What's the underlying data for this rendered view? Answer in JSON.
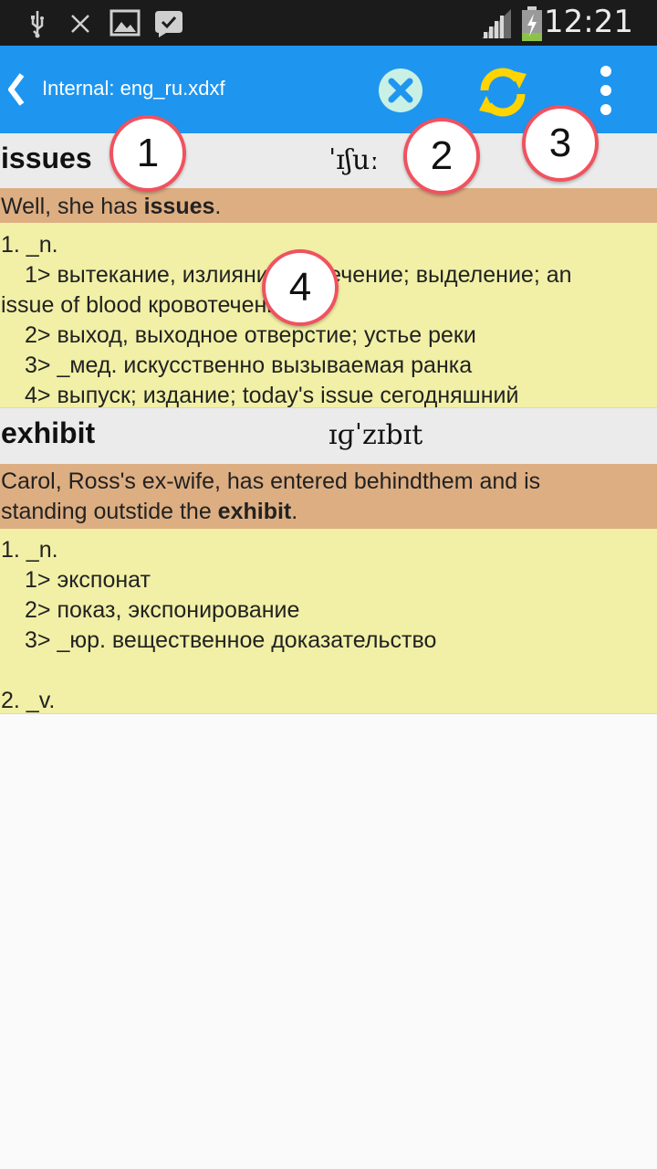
{
  "status_bar": {
    "time": "12:21",
    "icons": [
      "usb-icon",
      "missed-call-icon",
      "image-icon",
      "chat-check-icon",
      "signal-icon",
      "battery-charging-icon"
    ]
  },
  "app_bar": {
    "title": "Internal: eng_ru.xdxf",
    "icons": [
      "back-chevron-icon",
      "close-icon",
      "refresh-icon",
      "overflow-menu-icon"
    ],
    "colors": {
      "bar": "#1e96f0",
      "close": "#1e96f0",
      "refresh": "#ffd400"
    }
  },
  "entries": [
    {
      "word": "issues",
      "ipa": "ˈɪʃuː",
      "example": {
        "pre": "Well, she has ",
        "bold": "issues",
        "post": "."
      },
      "definitions": [
        "1. _n.",
        "1> вытекание, излияние; истечение; выделение; an",
        "issue of blood кровотечение",
        "2> выход, выходное отверстие; устье реки",
        "3> _мед. искусственно вызываемая ранка",
        "4> выпуск; издание; today's issue сегодняшний"
      ]
    },
    {
      "word": "exhibit",
      "ipa": "ɪɡˈzɪbɪt",
      "example": {
        "line1": "Carol, Ross's ex-wife, has entered behindthem and is",
        "pre": "standing outstide the ",
        "bold": "exhibit",
        "post": "."
      },
      "definitions": [
        "1. _n.",
        "1> экспонат",
        "2> показ, экспонирование",
        "3> _юр. вещественное доказательство",
        "2. _v."
      ]
    }
  ],
  "callouts": [
    "1",
    "2",
    "3",
    "4"
  ]
}
